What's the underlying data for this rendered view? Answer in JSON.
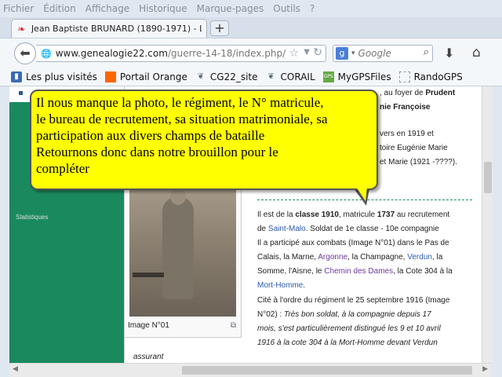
{
  "menu": [
    "Fichier",
    "Édition",
    "Affichage",
    "Historique",
    "Marque-pages",
    "Outils",
    "?"
  ],
  "tab": {
    "title": "Jean Baptiste BRUNARD (1890-1971) - Le..."
  },
  "newtab_label": "+",
  "url": {
    "host": "www.genealogie22.com",
    "path": "/guerre-14-18/index.php/Jear"
  },
  "search": {
    "engine": "g",
    "placeholder": "Google"
  },
  "bookmarks": [
    {
      "label": "Les plus visités",
      "icon": "bookmarks-icon"
    },
    {
      "label": "Portail Orange",
      "icon": "orange-icon"
    },
    {
      "label": "CG22_site",
      "icon": "cg22-icon"
    },
    {
      "label": "CORAIL",
      "icon": "corail-icon"
    },
    {
      "label": "MyGPSFiles",
      "icon": "mygps-icon"
    },
    {
      "label": "RandoGPS",
      "icon": "folder-icon"
    }
  ],
  "article": {
    "lines_top": [
      ", au foyer de ",
      "Prudent",
      "nie Françoise",
      "vers en 1919 et",
      "toire Eugénie Marie",
      "et Marie (1921 -????)."
    ],
    "p1": {
      "l1a": "Il est de la ",
      "l1b": "classe 1910",
      "l1c": ", matricule ",
      "l1d": "1737",
      "l1e": " au recrutement",
      "l2a": "de ",
      "l2b": "Saint-Malo",
      "l2c": ". Soldat de 1e classe - 10e compagnie",
      "l3": "Il a participé aux combats (Image N°01) dans le Pas de",
      "l4a": "Calais, la Marne, ",
      "l4b": "Argonne",
      "l4c": ", la Champagne, ",
      "l4d": "Verdun",
      "l4e": ", la",
      "l5a": "Somme, l'Aisne, le ",
      "l5b": "Chemin des Dames",
      "l5c": ", la Cote 304 à la",
      "l6": "Mort-Homme",
      "l6b": "."
    },
    "p2": {
      "l1": "Cité à l'ordre du régiment le 25 septembre 1916 (Image",
      "l2a": "N°02) : ",
      "l2b": "Très bon soldat, à la compagnie depuis 17",
      "l3": "mois, s'est particulièrement distingué les 9 et 10 avril",
      "l4": "1916 à la cote 304 à la Mort-Homme devant Verdun"
    },
    "photo_caption": "Image N°01",
    "bottom_word": "assurant",
    "left_peek": "Statistiques"
  },
  "tooltip": {
    "lines": [
      "Il nous manque la photo, le régiment, le N° matricule,",
      "le bureau de recrutement, sa situation matrimoniale, sa",
      "participation aux divers champs de bataille",
      "Retournons donc dans notre brouillon pour le",
      "compléter"
    ]
  }
}
